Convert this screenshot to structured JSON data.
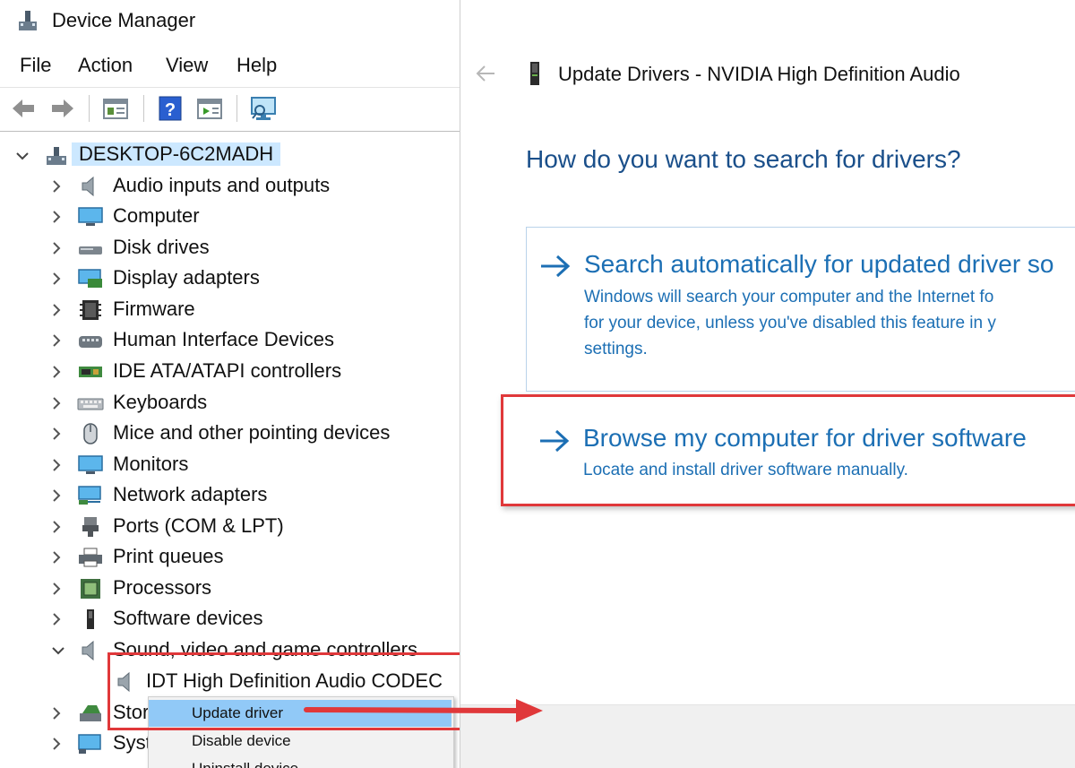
{
  "device_manager": {
    "title": "Device Manager",
    "menu": [
      "File",
      "Action",
      "View",
      "Help"
    ],
    "toolbar_icons": [
      "back-arrow-icon",
      "forward-arrow-icon",
      "properties-icon",
      "help-icon",
      "update-driver-icon",
      "scan-hardware-icon"
    ],
    "root": "DESKTOP-6C2MADH",
    "tree": [
      {
        "label": "Audio inputs and outputs",
        "icon": "speaker-icon"
      },
      {
        "label": "Computer",
        "icon": "computer-icon"
      },
      {
        "label": "Disk drives",
        "icon": "disk-drive-icon"
      },
      {
        "label": "Display adapters",
        "icon": "display-adapter-icon"
      },
      {
        "label": "Firmware",
        "icon": "firmware-icon"
      },
      {
        "label": "Human Interface Devices",
        "icon": "hid-icon"
      },
      {
        "label": "IDE ATA/ATAPI controllers",
        "icon": "ide-controller-icon"
      },
      {
        "label": "Keyboards",
        "icon": "keyboard-icon"
      },
      {
        "label": "Mice and other pointing devices",
        "icon": "mouse-icon"
      },
      {
        "label": "Monitors",
        "icon": "monitor-icon"
      },
      {
        "label": "Network adapters",
        "icon": "network-adapter-icon"
      },
      {
        "label": "Ports (COM & LPT)",
        "icon": "port-icon"
      },
      {
        "label": "Print queues",
        "icon": "printer-icon"
      },
      {
        "label": "Processors",
        "icon": "processor-icon"
      },
      {
        "label": "Software devices",
        "icon": "software-device-icon"
      },
      {
        "label": "Sound, video and game controllers",
        "icon": "speaker-icon"
      }
    ],
    "expanded_child": "IDT High Definition Audio CODEC",
    "truncated_rows": [
      "Stor",
      "Syst"
    ],
    "context_menu": [
      "Update driver",
      "Disable device",
      "Uninstall device"
    ]
  },
  "update_drivers": {
    "title": "Update Drivers - NVIDIA High Definition Audio",
    "question": "How do you want to search for drivers?",
    "options": [
      {
        "heading": "Search automatically for updated driver so",
        "description": [
          "Windows will search your computer and the Internet fo",
          "for your device, unless you've disabled this feature in y",
          "settings."
        ]
      },
      {
        "heading": "Browse my computer for driver software",
        "description": [
          "Locate and install driver software manually."
        ]
      }
    ]
  },
  "colors": {
    "accent_blue": "#1c6fb4",
    "selection_blue": "#91c9f7",
    "highlight_red": "#e0383a"
  }
}
